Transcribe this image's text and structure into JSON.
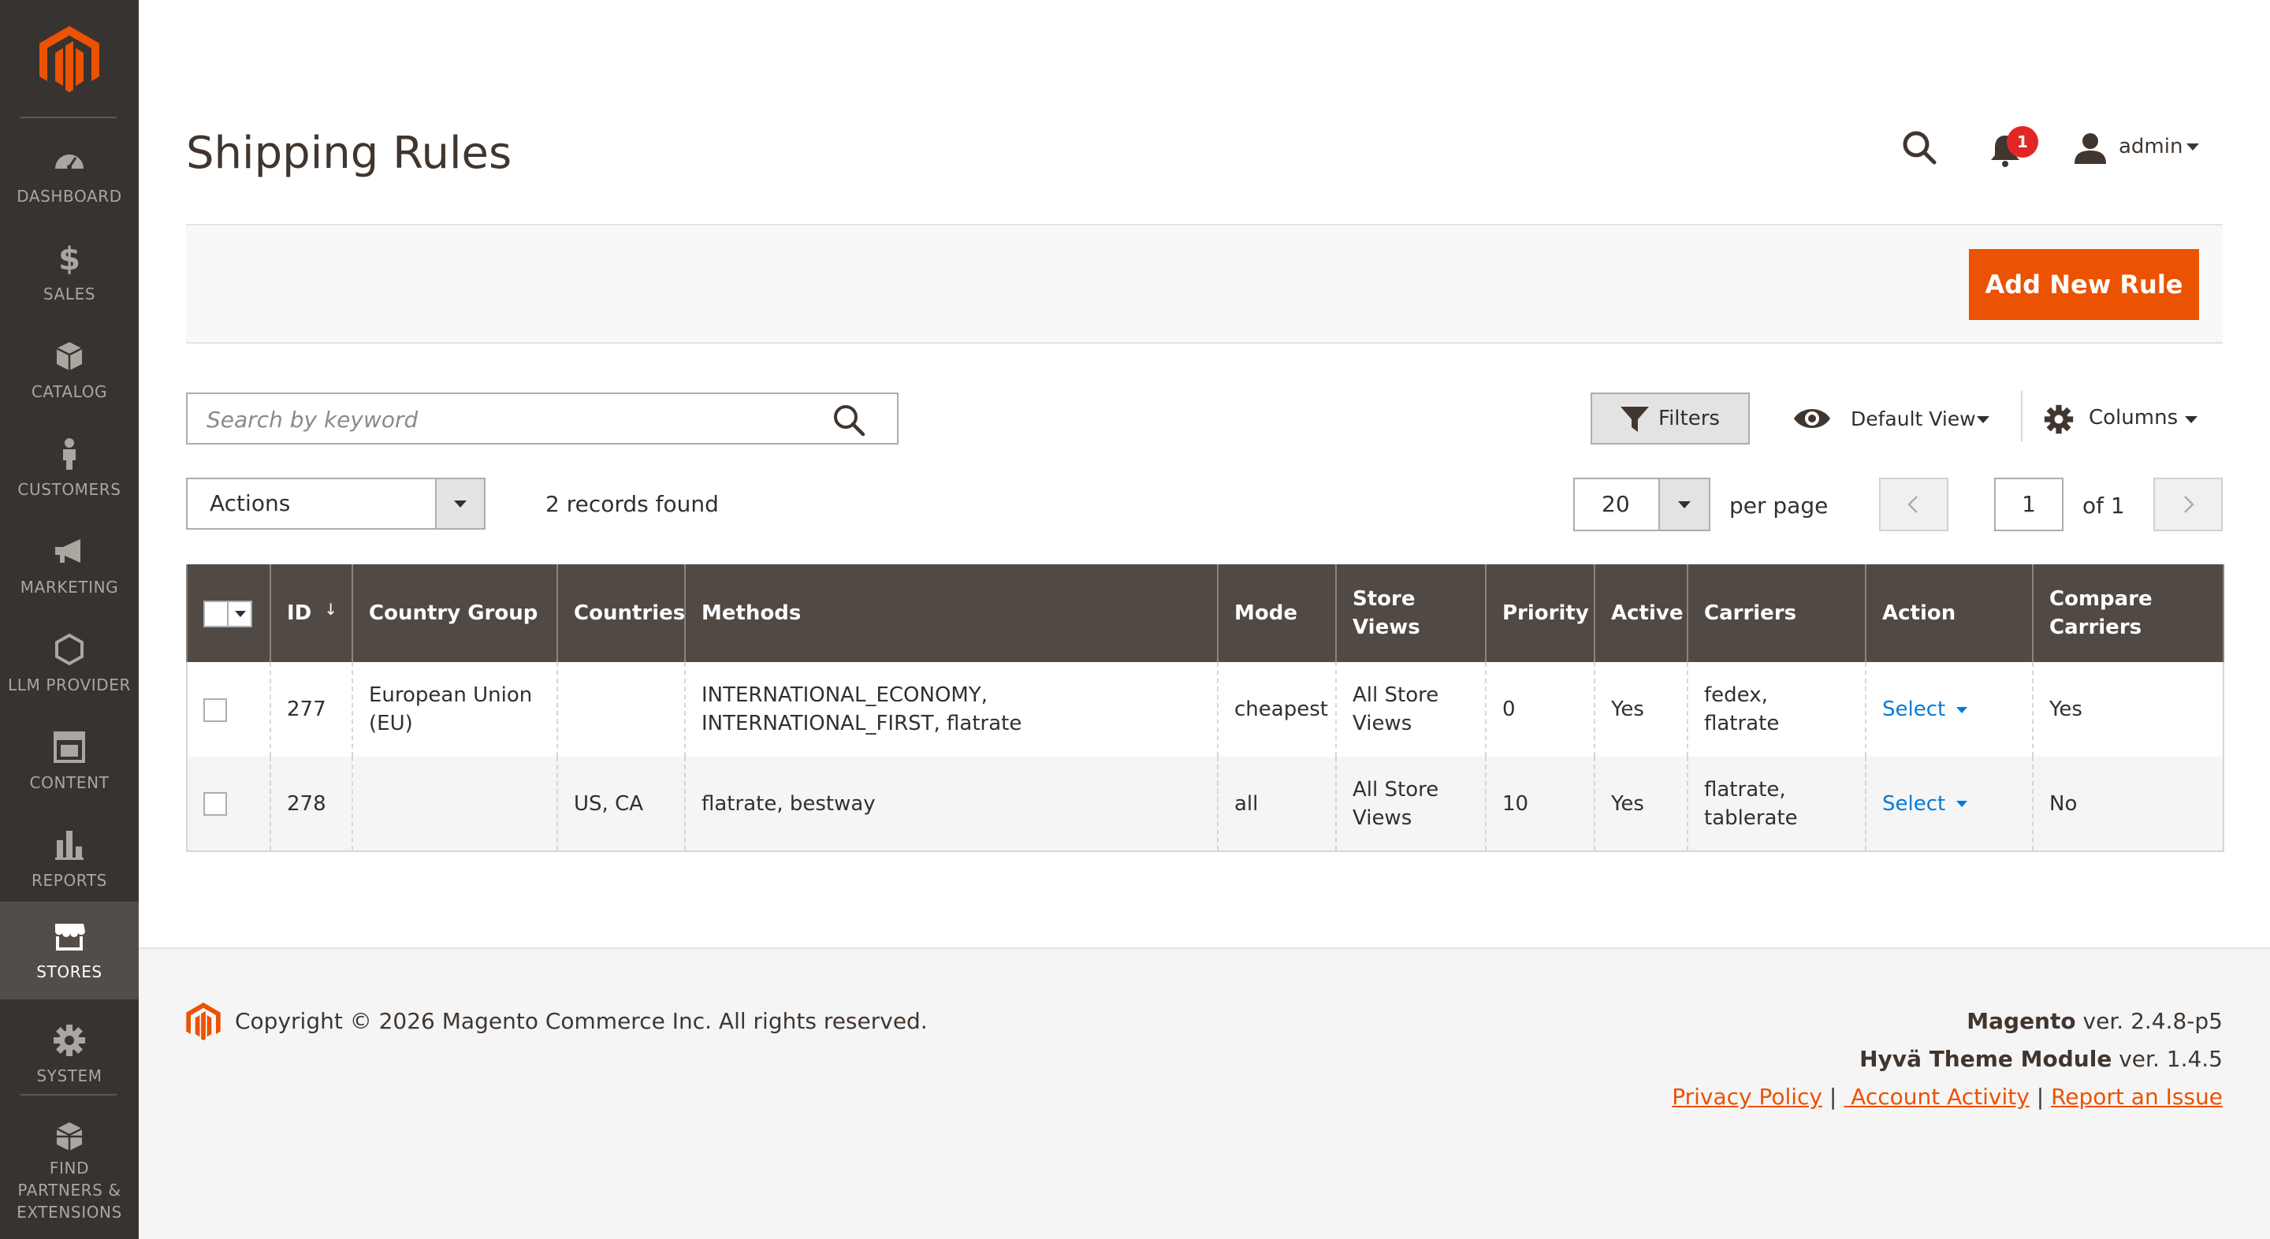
{
  "sidebar": {
    "items": [
      {
        "label": "DASHBOARD",
        "icon": "dashboard-icon"
      },
      {
        "label": "SALES",
        "icon": "dollar-icon"
      },
      {
        "label": "CATALOG",
        "icon": "cube-icon"
      },
      {
        "label": "CUSTOMERS",
        "icon": "person-icon"
      },
      {
        "label": "MARKETING",
        "icon": "megaphone-icon"
      },
      {
        "label": "LLM PROVIDER",
        "icon": "hexagon-icon"
      },
      {
        "label": "CONTENT",
        "icon": "layout-icon"
      },
      {
        "label": "REPORTS",
        "icon": "bar-chart-icon"
      },
      {
        "label": "STORES",
        "icon": "storefront-icon"
      },
      {
        "label": "SYSTEM",
        "icon": "gear-icon"
      },
      {
        "label": "FIND PARTNERS & EXTENSIONS",
        "icon": "boxes-icon"
      }
    ],
    "active": "STORES"
  },
  "header": {
    "title": "Shipping Rules",
    "notification_count": "1",
    "user_name": "admin"
  },
  "toolbar": {
    "add_label": "Add New Rule",
    "search_placeholder": "Search by keyword",
    "filters_label": "Filters",
    "view_label": "Default View",
    "columns_label": "Columns",
    "actions_label": "Actions",
    "records_found": "2 records found",
    "per_page_value": "20",
    "per_page_label": "per page",
    "current_page": "1",
    "of_pages": "of 1"
  },
  "grid": {
    "headers": {
      "id": "ID",
      "sort_arrow": "↓",
      "country_group": "Country Group",
      "countries": "Countries",
      "methods": "Methods",
      "mode": "Mode",
      "store_views": "Store Views",
      "priority": "Priority",
      "active": "Active",
      "carriers": "Carriers",
      "action": "Action",
      "compare_carriers": "Compare Carriers"
    },
    "rows": [
      {
        "id": "277",
        "country_group": "European Union (EU)",
        "countries": "",
        "methods": "INTERNATIONAL_ECONOMY, INTERNATIONAL_FIRST, flatrate",
        "mode": "cheapest",
        "store_views": "All Store Views",
        "priority": "0",
        "active": "Yes",
        "carriers": "fedex, flatrate",
        "action": "Select",
        "compare_carriers": "Yes"
      },
      {
        "id": "278",
        "country_group": "",
        "countries": "US, CA",
        "methods": "flatrate, bestway",
        "mode": "all",
        "store_views": "All Store Views",
        "priority": "10",
        "active": "Yes",
        "carriers": "flatrate, tablerate",
        "action": "Select",
        "compare_carriers": "No"
      }
    ]
  },
  "footer": {
    "copyright": "Copyright © 2026 Magento Commerce Inc. All rights reserved.",
    "magento_name": "Magento",
    "magento_version": " ver. 2.4.8-p5",
    "hyva_name": "Hyvä Theme Module",
    "hyva_version": " ver. 1.4.5",
    "privacy": "Privacy Policy",
    "sep1": " | ",
    "account_activity": " Account Activity",
    "sep2": " | ",
    "report_issue": "Report an Issue"
  },
  "colors": {
    "brand_orange": "#eb5202",
    "sidebar_bg": "#373330",
    "sidebar_active_bg": "#524d49",
    "grid_header_bg": "#514943",
    "link_blue": "#007bdb",
    "badge_red": "#e22626"
  }
}
